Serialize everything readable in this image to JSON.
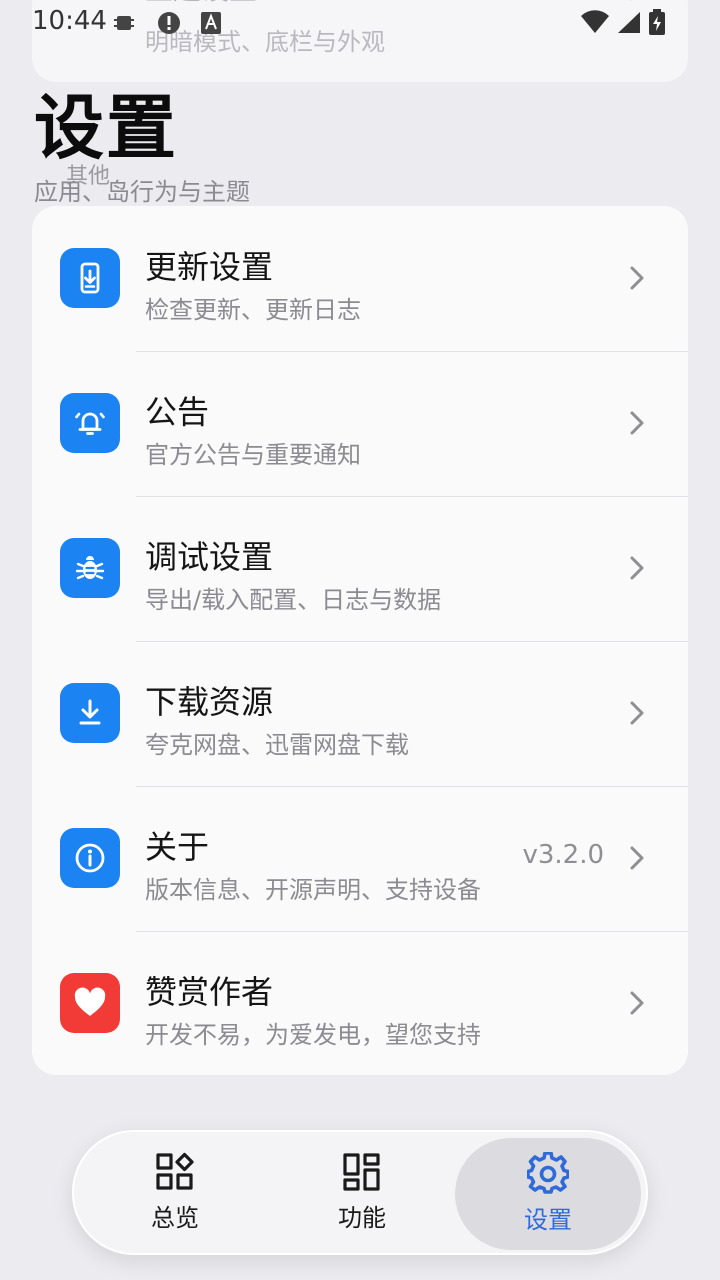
{
  "status_bar": {
    "time": "10:44"
  },
  "scrolled_card": {
    "title": "主题设置",
    "subtitle": "明暗模式、底栏与外观"
  },
  "header": {
    "title": "设置",
    "ghost_label": "其他",
    "subtitle": "应用、岛行为与主题"
  },
  "settings": [
    {
      "title": "更新设置",
      "subtitle": "检查更新、更新日志",
      "icon": "phone-download-icon",
      "value": ""
    },
    {
      "title": "公告",
      "subtitle": "官方公告与重要通知",
      "icon": "bell-ringing-icon",
      "value": ""
    },
    {
      "title": "调试设置",
      "subtitle": "导出/载入配置、日志与数据",
      "icon": "bug-icon",
      "value": ""
    },
    {
      "title": "下载资源",
      "subtitle": "夸克网盘、迅雷网盘下载",
      "icon": "download-icon",
      "value": ""
    },
    {
      "title": "关于",
      "subtitle": "版本信息、开源声明、支持设备",
      "icon": "info-icon",
      "value": "v3.2.0"
    },
    {
      "title": "赞赏作者",
      "subtitle": "开发不易，为爱发电，望您支持",
      "icon": "heart-icon",
      "value": ""
    }
  ],
  "colors": {
    "accent": "#1b83f2",
    "danger": "#f23b36",
    "nav_active": "#2f6ad8"
  },
  "bottom_nav": [
    {
      "label": "总览",
      "icon": "overview-icon",
      "active": false
    },
    {
      "label": "功能",
      "icon": "grid-icon",
      "active": false
    },
    {
      "label": "设置",
      "icon": "gear-icon",
      "active": true
    }
  ]
}
